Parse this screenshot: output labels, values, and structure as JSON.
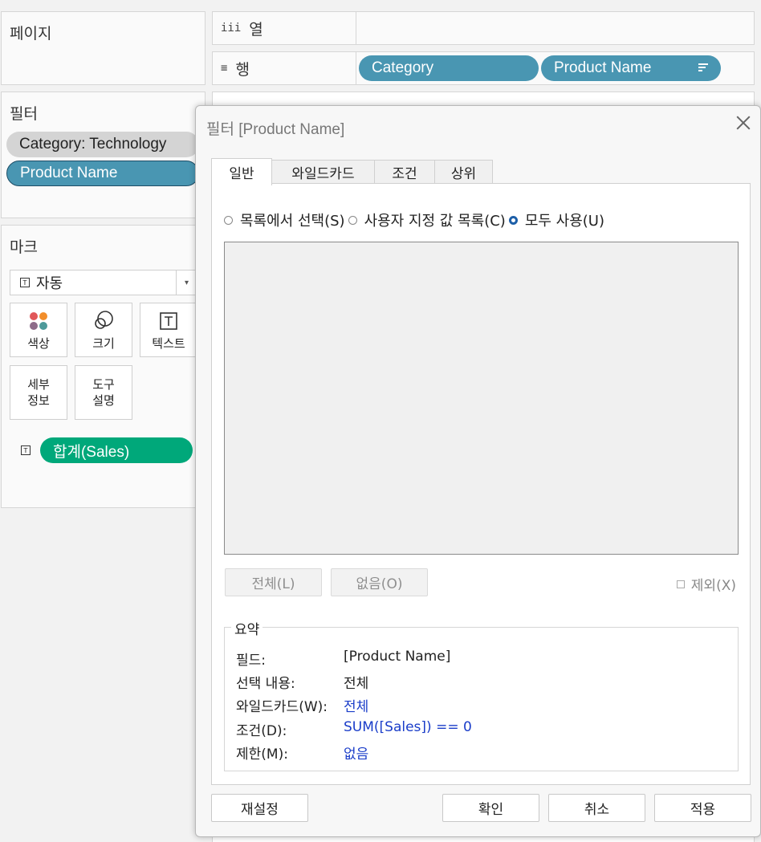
{
  "pages": {
    "title": "페이지"
  },
  "columns_shelf": {
    "icon": "iii",
    "label": "열"
  },
  "rows_shelf": {
    "icon": "≡",
    "label": "행",
    "pills": [
      "Category",
      "Product Name"
    ]
  },
  "filters": {
    "title": "필터",
    "items": [
      "Category: Technology",
      "Product Name"
    ]
  },
  "marks": {
    "title": "마크",
    "type_icon": "T",
    "type": "자동",
    "buttons": {
      "color": "색상",
      "size": "크기",
      "text": "텍스트",
      "detail_line1": "세부",
      "detail_line2": "정보",
      "tooltip_line1": "도구",
      "tooltip_line2": "설명"
    },
    "text_icon": "T",
    "measure_pill": "합계(Sales)"
  },
  "dialog": {
    "title": "필터 [Product Name]",
    "tabs": [
      "일반",
      "와일드카드",
      "조건",
      "상위"
    ],
    "radios": [
      "목록에서 선택(S)",
      "사용자 지정 값 목록(C)",
      "모두 사용(U)"
    ],
    "selected_radio": 2,
    "all_button": "전체(L)",
    "none_button": "없음(O)",
    "exclude_label": "제외(X)",
    "summary": {
      "legend": "요약",
      "rows": [
        {
          "key": "필드:",
          "value": "[Product Name]"
        },
        {
          "key": "선택 내용:",
          "value": "전체"
        },
        {
          "key": "와일드카드(W):",
          "value": "전체"
        },
        {
          "key": "조건(D):",
          "value": "SUM([Sales]) == 0"
        },
        {
          "key": "제한(M):",
          "value": "없음"
        }
      ]
    },
    "reset_button": "재설정",
    "ok_button": "확인",
    "cancel_button": "취소",
    "apply_button": "적용"
  },
  "colors": {
    "pill_blue": "#4996b2",
    "pill_green": "#00a87a",
    "summary_link": "#1a3dc9",
    "radio_checked": "#1d5fa8"
  }
}
